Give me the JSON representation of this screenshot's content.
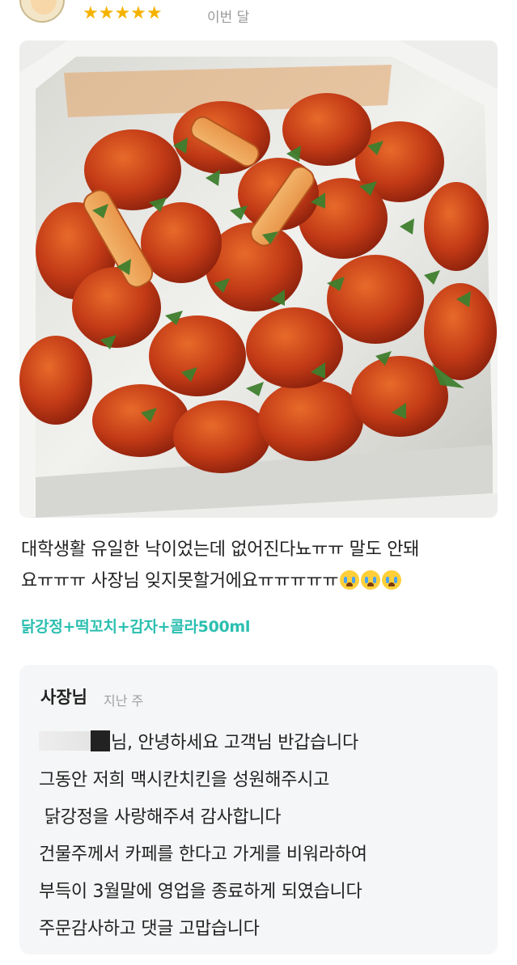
{
  "review": {
    "rating_stars": "★★★★★",
    "rating": 5,
    "date": "이번 달",
    "text_line1": "대학생활 유일한 낙이었는데 없어진다뇨ㅠㅠ 말도 안돼",
    "text_line2": "요ㅠㅠㅠ 사장님 잊지못할거에요ㅠㅠㅠㅠㅠ",
    "emoji": "loudly-crying-face",
    "emoji_count": 3,
    "menu": "닭강정+떡꼬치+감자+콜라500ml"
  },
  "owner_reply": {
    "name": "사장님",
    "date": "지난 주",
    "lines": [
      "님, 안녕하세요 고객님 반갑습니다",
      "그동안 저희 맥시칸치킨을 성원해주시고",
      " 닭강정을 사랑해주셔 감사합니다",
      "건물주께서 카페를 한다고 가게를 비워라하여",
      "부득이 3월말에 영업을 종료하게 되였습니다",
      "주문감사하고 댓글 고맙습니다"
    ]
  },
  "colors": {
    "star": "#f5b301",
    "menu_tag": "#2bbfb0",
    "reply_bg": "#f5f6f7",
    "sauce": "#c8361a"
  }
}
